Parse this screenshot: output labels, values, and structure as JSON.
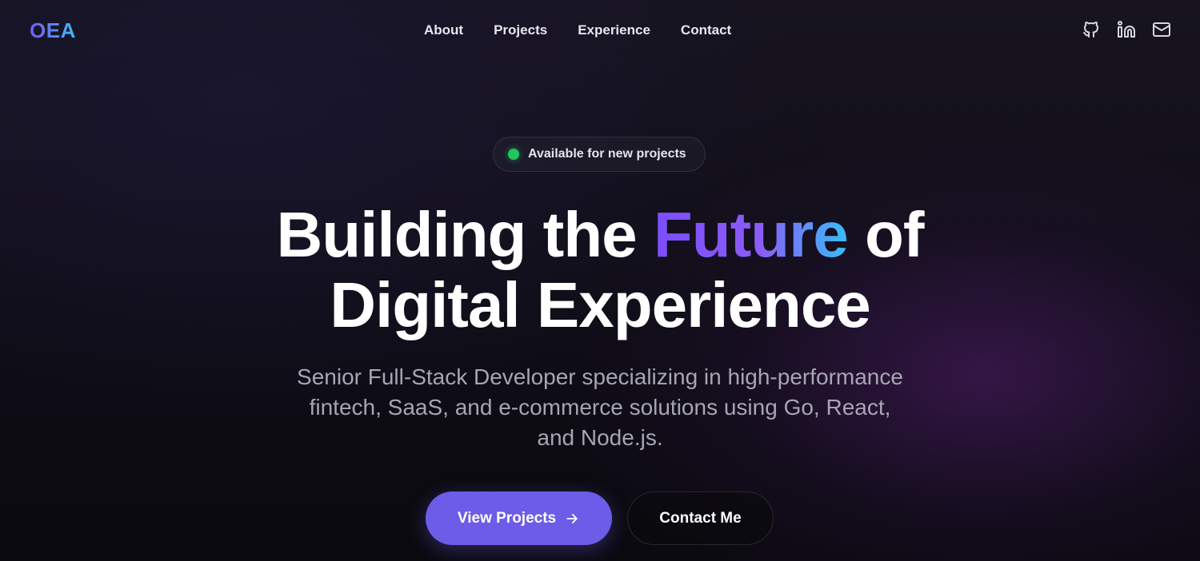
{
  "header": {
    "logo": "OEA",
    "nav": [
      {
        "label": "About"
      },
      {
        "label": "Projects"
      },
      {
        "label": "Experience"
      },
      {
        "label": "Contact"
      }
    ],
    "socials": [
      {
        "icon": "github-icon"
      },
      {
        "icon": "linkedin-icon"
      },
      {
        "icon": "mail-icon"
      }
    ]
  },
  "hero": {
    "badge": {
      "status_color": "#22c55e",
      "text": "Available for new projects"
    },
    "headline": {
      "part1": "Building the ",
      "accent": "Future",
      "part2": " of",
      "line2": "Digital Experience"
    },
    "subtitle": "Senior Full-Stack Developer specializing in high-performance fintech, SaaS, and e-commerce solutions using Go, React, and Node.js.",
    "buttons": {
      "primary": {
        "label": "View Projects",
        "icon": "arrow-right-icon"
      },
      "secondary": {
        "label": "Contact Me"
      }
    }
  },
  "colors": {
    "accent": "#6c5ce7",
    "gradient_start": "#7c4dff",
    "gradient_end": "#38bdf8",
    "background": "#0f0d16"
  }
}
